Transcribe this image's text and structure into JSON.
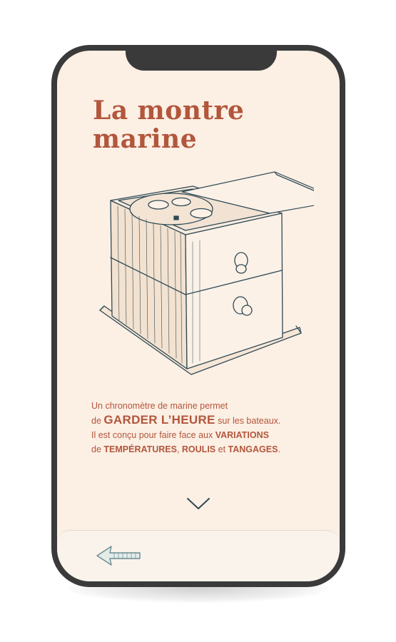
{
  "screen": {
    "title_line1": "La montre",
    "title_line2": "marine"
  },
  "description": {
    "line1": "Un chronomètre de marine permet",
    "line2_pre": "de ",
    "line2_emph": "GARDER L’HEURE",
    "line2_post": " sur les bateaux.",
    "line3_pre": "Il est conçu pour faire face aux ",
    "line3_emph": "VARIATIONS",
    "line4_pre": "de ",
    "line4_emph1": "TEMPÉRATURES",
    "line4_sep": ", ",
    "line4_emph2": "ROULIS",
    "line4_and": " et ",
    "line4_emph3": "TANGAGES",
    "line4_end": "."
  },
  "icons": {
    "scroll_down": "chevron-down-icon",
    "back": "arrow-left-icon",
    "illustration": "marine-chronometer-box-illustration"
  },
  "colors": {
    "background": "#fcefe4",
    "accent": "#b2563c",
    "ink": "#2f4a55",
    "frame": "#3a3a3a",
    "bottom_bar": "#faf3ec"
  }
}
